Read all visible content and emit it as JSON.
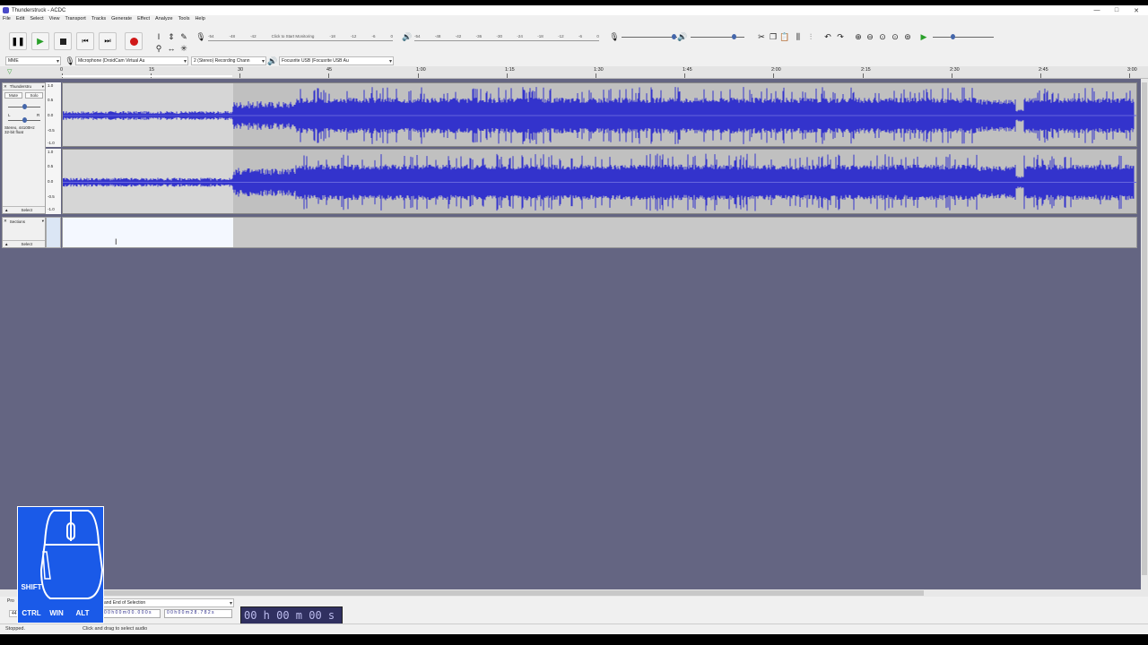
{
  "window": {
    "title": "Thunderstruck - ACDC",
    "min": "—",
    "max": "□",
    "close": "✕"
  },
  "menu": [
    "File",
    "Edit",
    "Select",
    "View",
    "Transport",
    "Tracks",
    "Generate",
    "Effect",
    "Analyze",
    "Tools",
    "Help"
  ],
  "record_meter": {
    "labels": [
      "-54",
      "-48",
      "-42",
      "Click to Start Monitoring",
      "-18",
      "-12",
      "-6",
      "0"
    ]
  },
  "play_meter": {
    "labels": [
      "-54",
      "-48",
      "-42",
      "-36",
      "-30",
      "-24",
      "-18",
      "-12",
      "-6",
      "0"
    ]
  },
  "devices": {
    "host": "MME",
    "input": "Microphone (DroidCam Virtual Au",
    "channels": "2 (Stereo) Recording Chann",
    "output": "Focusrite USB (Focusrite USB Au"
  },
  "timeline": {
    "ticks": [
      "0",
      "15",
      "30",
      "45",
      "1:00",
      "1:15",
      "1:30",
      "1:45",
      "2:00",
      "2:15",
      "2:30",
      "2:45",
      "3:00"
    ]
  },
  "audio_track": {
    "name": "Thunderstru",
    "mute": "Mute",
    "solo": "Solo",
    "pan_l": "L",
    "pan_r": "R",
    "info1": "Stereo, 44100Hz",
    "info2": "32-bit float",
    "select": "Select",
    "ruler": [
      "1.0",
      "0.5",
      "0.0",
      "-0.5",
      "-1.0"
    ]
  },
  "label_track": {
    "name": "Sections",
    "select": "Select"
  },
  "selection": {
    "project_rate_label": "Pro",
    "project_rate_value": "44",
    "mode": "and End of Selection",
    "start": "0 0 h 0 0 m 0 0 . 0 0 0 s",
    "end": "0 0 h 0 0 m 2 8 . 7 8 2 s",
    "time": "00 h 00 m 00 s"
  },
  "status": {
    "left": "Stopped.",
    "hint": "Click and drag to select audio"
  },
  "keyboard_overlay": {
    "shift": "SHIFT",
    "ctrl": "CTRL",
    "win": "WIN",
    "alt": "ALT"
  },
  "colors": {
    "wave": "#3333cc",
    "background": "#646582",
    "selection": "#ffffff"
  }
}
